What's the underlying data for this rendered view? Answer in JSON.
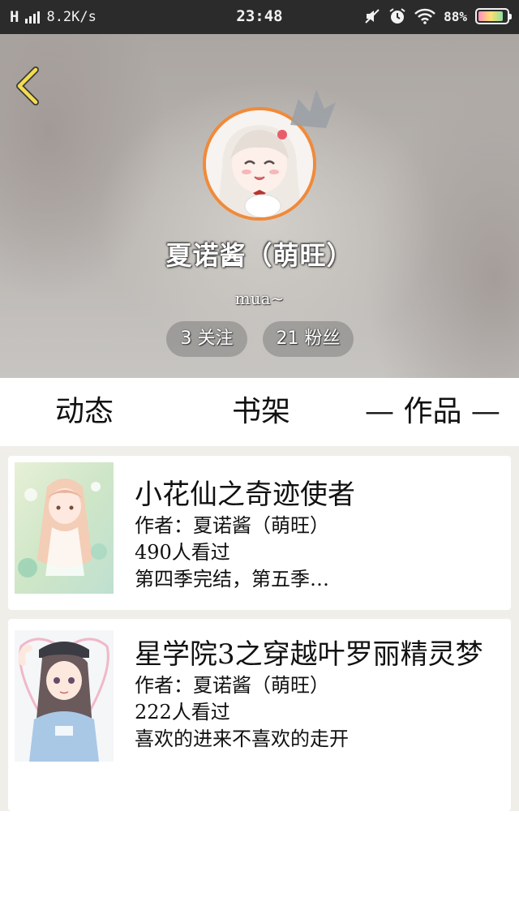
{
  "status_bar": {
    "signal": "H",
    "speed": "8.2K/s",
    "time": "23:48",
    "battery": "88%",
    "icons": [
      "mute-icon",
      "alarm-icon",
      "wifi-icon",
      "battery-icon"
    ]
  },
  "profile": {
    "nickname": "夏诺酱（萌旺）",
    "signature": "mua~",
    "following": "3 关注",
    "fans": "21 粉丝",
    "avatar_ring_color": "#f08a3a"
  },
  "tabs": [
    {
      "label": "动态"
    },
    {
      "label": "书架"
    },
    {
      "label": "— 作品 —",
      "active": true
    }
  ],
  "works": [
    {
      "title": "小花仙之奇迹使者",
      "author": "作者：夏诺酱（萌旺）",
      "views": "490人看过",
      "desc": "第四季完结，第五季…"
    },
    {
      "title": "星学院3之穿越叶罗丽精灵梦",
      "author": "作者：夏诺酱（萌旺）",
      "views": "222人看过",
      "desc": "喜欢的进来不喜欢的走开"
    }
  ]
}
